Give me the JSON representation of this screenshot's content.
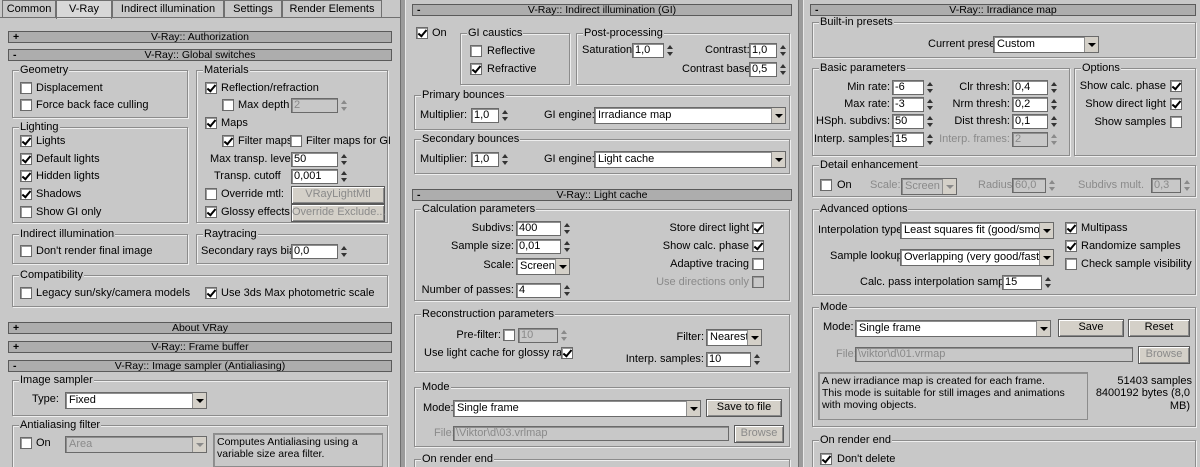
{
  "tabs": [
    "Common",
    "V-Ray",
    "Indirect illumination",
    "Settings",
    "Render Elements"
  ],
  "left": {
    "rollouts": {
      "authorization": "V-Ray:: Authorization",
      "global": "V-Ray:: Global switches",
      "about": "About VRay",
      "framebuffer": "V-Ray:: Frame buffer",
      "imagesampler": "V-Ray:: Image sampler (Antialiasing)"
    },
    "geometry": {
      "title": "Geometry",
      "displacement": "Displacement",
      "force_back": "Force back face culling"
    },
    "lighting": {
      "title": "Lighting",
      "lights": "Lights",
      "default_lights": "Default lights",
      "hidden_lights": "Hidden lights",
      "shadows": "Shadows",
      "show_gi_only": "Show GI only"
    },
    "materials": {
      "title": "Materials",
      "reflection": "Reflection/refraction",
      "max_depth": "Max depth",
      "max_depth_val": "2",
      "maps": "Maps",
      "filter_maps": "Filter maps",
      "filter_maps_gi": "Filter maps for GI",
      "max_transp": "Max transp. levels",
      "max_transp_val": "50",
      "transp_cutoff": "Transp. cutoff",
      "transp_cutoff_val": "0,001",
      "override_mtl": "Override mtl:",
      "override_mtl_btn": "VRayLightMtl",
      "glossy": "Glossy effects",
      "override_exclude": "Override Exclude..."
    },
    "indirect": {
      "title": "Indirect illumination",
      "dont_render": "Don't render final image"
    },
    "raytracing": {
      "title": "Raytracing",
      "secondary_bias": "Secondary rays bias",
      "secondary_bias_val": "0,0"
    },
    "compat": {
      "title": "Compatibility",
      "legacy": "Legacy sun/sky/camera models",
      "photometric": "Use 3ds Max photometric scale"
    },
    "image_sampler": {
      "title": "Image sampler",
      "type_label": "Type:",
      "type_val": "Fixed"
    },
    "aa_filter": {
      "title": "Antialiasing filter",
      "on": "On",
      "filter_val": "Area",
      "description": "Computes Antialiasing using a variable size area filter."
    }
  },
  "middle": {
    "rollouts": {
      "gi": "V-Ray:: Indirect illumination (GI)",
      "lightcache": "V-Ray:: Light cache"
    },
    "on": "On",
    "caustics": {
      "title": "GI caustics",
      "reflective": "Reflective",
      "refractive": "Refractive"
    },
    "post": {
      "title": "Post-processing",
      "saturation": "Saturation:",
      "saturation_val": "1,0",
      "contrast": "Contrast:",
      "contrast_val": "1,0",
      "contrast_base": "Contrast base:",
      "contrast_base_val": "0,5"
    },
    "primary": {
      "title": "Primary bounces",
      "multiplier": "Multiplier:",
      "multiplier_val": "1,0",
      "engine_label": "GI engine:",
      "engine_val": "Irradiance map"
    },
    "secondary": {
      "title": "Secondary bounces",
      "multiplier": "Multiplier:",
      "multiplier_val": "1,0",
      "engine_label": "GI engine:",
      "engine_val": "Light cache"
    },
    "calc": {
      "title": "Calculation parameters",
      "subdivs": "Subdivs:",
      "subdivs_val": "400",
      "sample_size": "Sample size:",
      "sample_size_val": "0,01",
      "scale": "Scale:",
      "scale_val": "Screen",
      "passes": "Number of passes:",
      "passes_val": "4",
      "store_direct": "Store direct light",
      "show_calc": "Show calc. phase",
      "adaptive": "Adaptive tracing",
      "use_dirs": "Use directions only"
    },
    "recon": {
      "title": "Reconstruction parameters",
      "prefilter": "Pre-filter:",
      "prefilter_val": "10",
      "use_lc_glossy": "Use light cache for glossy rays",
      "filter": "Filter:",
      "filter_val": "Nearest",
      "interp": "Interp. samples:",
      "interp_val": "10"
    },
    "mode": {
      "title": "Mode",
      "mode_label": "Mode:",
      "mode_val": "Single frame",
      "save": "Save to file",
      "file_label": "File:",
      "file_val": "\\Viktor\\d\\03.vrlmap",
      "browse": "Browse"
    },
    "on_render_end": "On render end"
  },
  "right": {
    "rollout": "V-Ray:: Irradiance map",
    "presets": {
      "title": "Built-in presets",
      "current_label": "Current preset:",
      "current_val": "Custom"
    },
    "basic": {
      "title": "Basic parameters",
      "min_rate": "Min rate:",
      "min_rate_val": "-6",
      "max_rate": "Max rate:",
      "max_rate_val": "-3",
      "hsph": "HSph. subdivs:",
      "hsph_val": "50",
      "interp": "Interp. samples:",
      "interp_val": "15",
      "clr": "Clr thresh:",
      "clr_val": "0,4",
      "nrm": "Nrm thresh:",
      "nrm_val": "0,2",
      "dist": "Dist thresh:",
      "dist_val": "0,1",
      "interp_frames": "Interp. frames:",
      "interp_frames_val": "2"
    },
    "options": {
      "title": "Options",
      "show_calc": "Show calc. phase",
      "show_direct": "Show direct light",
      "show_samples": "Show samples"
    },
    "detail": {
      "title": "Detail enhancement",
      "on": "On",
      "scale": "Scale:",
      "scale_val": "Screen",
      "radius": "Radius:",
      "radius_val": "60,0",
      "subdivs_mult": "Subdivs mult.",
      "subdivs_mult_val": "0,3"
    },
    "advanced": {
      "title": "Advanced options",
      "interp_type": "Interpolation type:",
      "interp_type_val": "Least squares fit (good/smooth",
      "sample_lookup": "Sample lookup:",
      "sample_lookup_val": "Overlapping (very good/fast)",
      "calc_pass": "Calc. pass interpolation samples:",
      "calc_pass_val": "15",
      "multipass": "Multipass",
      "randomize": "Randomize samples",
      "check_vis": "Check sample visibility"
    },
    "mode": {
      "title": "Mode",
      "mode_label": "Mode:",
      "mode_val": "Single frame",
      "save": "Save",
      "reset": "Reset",
      "file_label": "File:",
      "file_val": "\\viktor\\d\\01.vrmap",
      "browse": "Browse",
      "description": "A new irradiance map is created for each frame.\nThis mode is suitable for still images and animations with moving objects.",
      "samples": "51403 samples",
      "bytes": "8400192 bytes (8,0 MB)"
    },
    "on_render_end": {
      "title": "On render end",
      "dont_delete": "Don't delete"
    }
  }
}
